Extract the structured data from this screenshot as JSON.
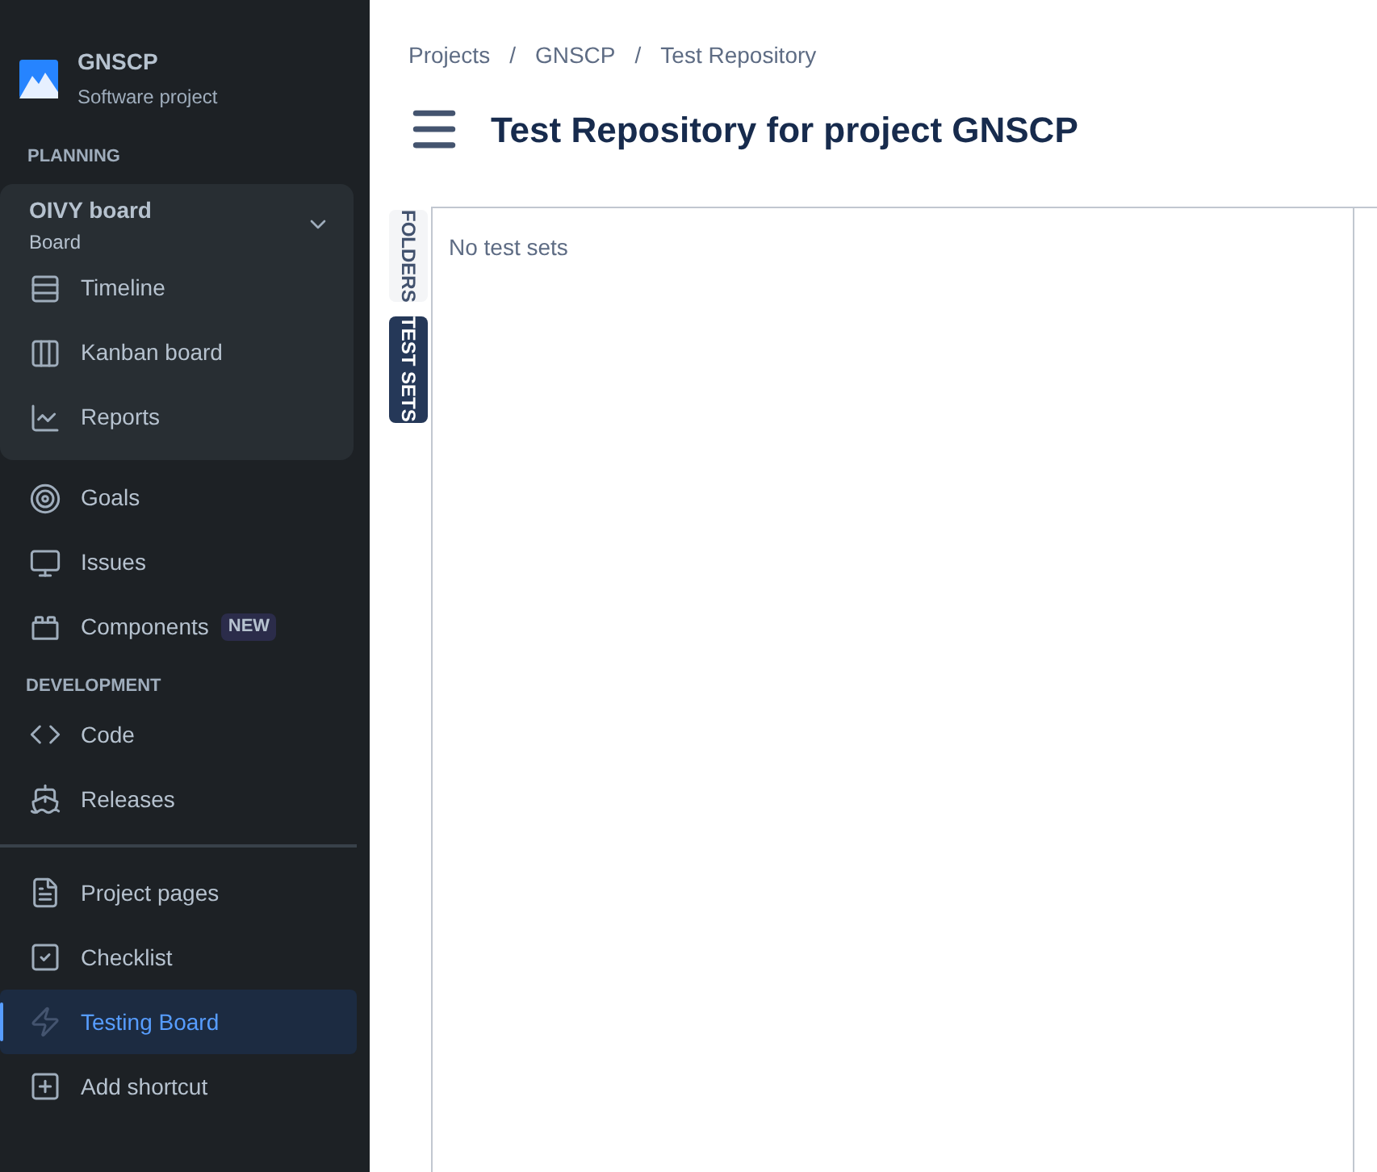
{
  "project": {
    "name": "GNSCP",
    "subtitle": "Software project"
  },
  "planning": {
    "heading": "PLANNING",
    "board": {
      "name": "OIVY board",
      "type": "Board",
      "expanded": true,
      "items": [
        {
          "label": "Timeline",
          "selected": false
        },
        {
          "label": "Kanban board",
          "selected": false
        },
        {
          "label": "Reports",
          "selected": false
        }
      ]
    },
    "items": [
      {
        "label": "Goals",
        "selected": false
      },
      {
        "label": "Issues",
        "selected": false
      },
      {
        "label": "Components",
        "badge": "NEW",
        "selected": false
      }
    ]
  },
  "development": {
    "heading": "DEVELOPMENT",
    "items": [
      {
        "label": "Code",
        "selected": false
      },
      {
        "label": "Releases",
        "selected": false
      }
    ]
  },
  "shortcuts": [
    {
      "label": "Project pages",
      "selected": false
    },
    {
      "label": "Checklist",
      "selected": false
    },
    {
      "label": "Testing Board",
      "selected": true
    },
    {
      "label": "Add shortcut",
      "selected": false
    }
  ],
  "breadcrumbs": [
    "Projects",
    "GNSCP",
    "Test Repository"
  ],
  "breadcrumb_separator": "/",
  "title": "Test Repository for project GNSCP",
  "side_tabs": [
    {
      "label": "FOLDERS",
      "selected": false
    },
    {
      "label": "TEST SETS",
      "selected": true
    }
  ],
  "empty_message": "No test sets"
}
